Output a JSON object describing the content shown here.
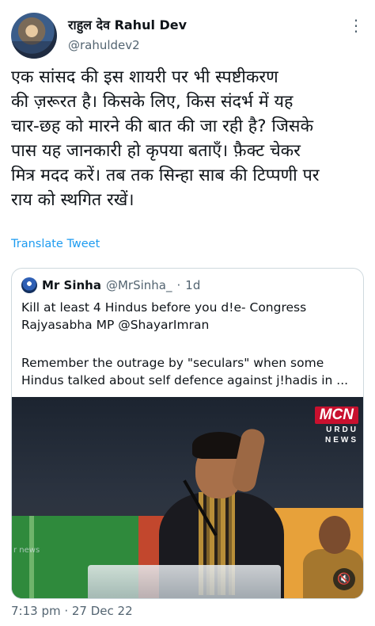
{
  "author": {
    "display_name": "राहुल देव  Rahul Dev",
    "handle": "@rahuldev2"
  },
  "tweet": {
    "text": "एक सांसद की इस शायरी पर भी स्पष्टीकरण\nकी ज़रूरत है। किसके लिए, किस संदर्भ में यह\nचार-छह को मारने की बात की जा रही है? जिसके\nपास यह जानकारी हो कृपया बताएँ। फ़ैक्ट चेकर\nमित्र मदद करें। तब तक सिन्हा साब की टिप्पणी पर\nराय को स्थगित रखें।",
    "translate_label": "Translate Tweet",
    "timestamp": "7:13 pm · 27 Dec 22"
  },
  "quoted": {
    "name": "Mr Sinha",
    "handle": "@MrSinha_",
    "dot": "·",
    "time": "1d",
    "text_1": "Kill at least 4 Hindus before you d!e- Congress\nRajyasabha MP @ShayarImran",
    "text_2": "Remember the outrage by \"seculars\" when some\nHindus talked about self defence against j!hadis in ...",
    "media": {
      "logo_main": "MCN",
      "logo_sub1": "URDU",
      "logo_sub2": "NEWS",
      "watermark": "r news"
    }
  },
  "icons": {
    "more": "more-icon",
    "mute": "volume-mute-icon"
  },
  "colors": {
    "link": "#1d9bf0",
    "secondary_text": "#536471",
    "border": "#cfd9de",
    "logo_red": "#c8102e"
  }
}
